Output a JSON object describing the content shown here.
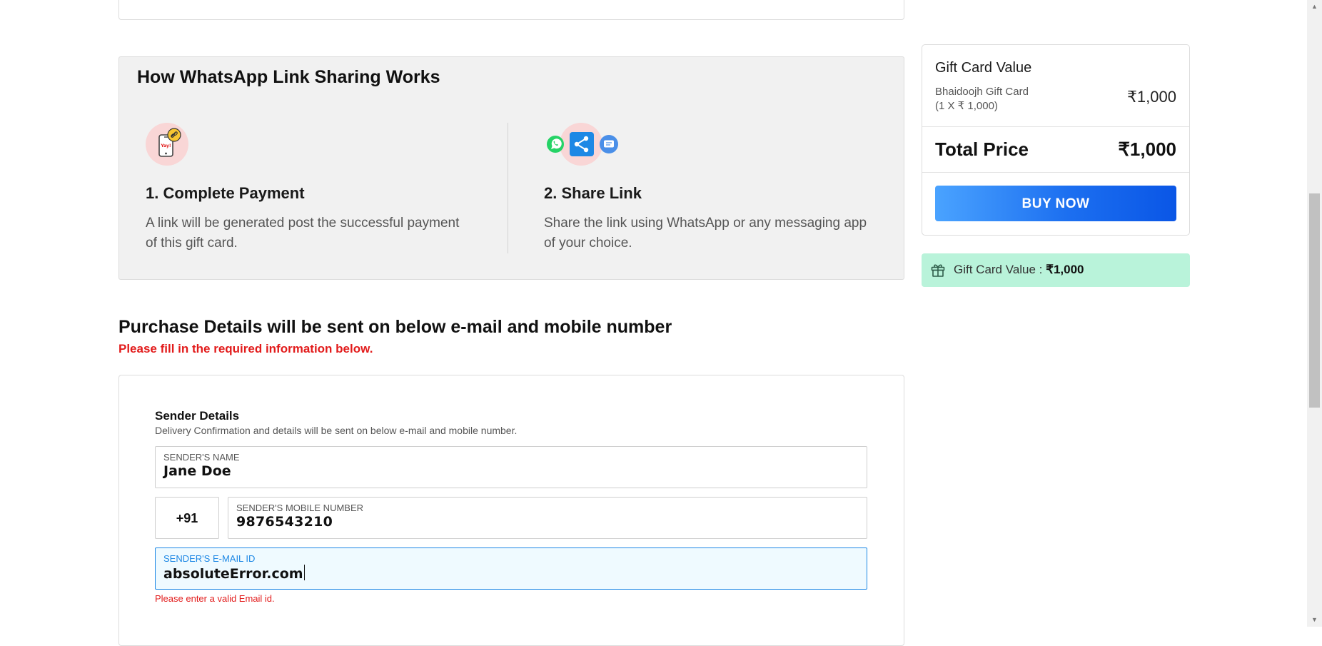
{
  "how_it_works": {
    "title": "How WhatsApp Link Sharing Works",
    "steps": [
      {
        "title": "1. Complete Payment",
        "desc_line1": "A link will be generated post the successful payment",
        "desc_line2": "of this gift card.",
        "icon": "phone-link-icon"
      },
      {
        "title": "2. Share Link",
        "desc_line1": "Share the link using WhatsApp or any messaging app",
        "desc_line2": "of your choice.",
        "icon": "share-icons"
      }
    ]
  },
  "summary": {
    "heading": "Gift Card Value",
    "item_name": "Bhaidoojh Gift Card",
    "item_qty": "(1 X ₹ 1,000)",
    "item_price": "₹1,000",
    "total_label": "Total Price",
    "total_value": "₹1,000",
    "buy_label": "BUY NOW"
  },
  "value_bar": {
    "label": "Gift Card Value : ",
    "value": "₹1,000"
  },
  "purchase": {
    "title": "Purchase Details will be sent on below e-mail and mobile number",
    "warning": "Please fill in the required information below."
  },
  "sender": {
    "title": "Sender Details",
    "desc": "Delivery Confirmation and details will be sent on below e-mail and mobile number.",
    "name_label": "SENDER'S NAME",
    "name_value": "Jane Doe",
    "country_code": "+91",
    "mobile_label": "SENDER'S MOBILE NUMBER",
    "mobile_value": "9876543210",
    "email_label": "SENDER'S E-MAIL ID",
    "email_value": "absoluteError.com",
    "email_error": "Please enter a valid Email id."
  },
  "colors": {
    "buy_gradient_start": "#4aa3ff",
    "buy_gradient_end": "#0a56e6",
    "value_bar_bg": "#b9f3da",
    "error": "#e21b1b",
    "focus": "#1e88e5",
    "whatsapp": "#25d366"
  }
}
